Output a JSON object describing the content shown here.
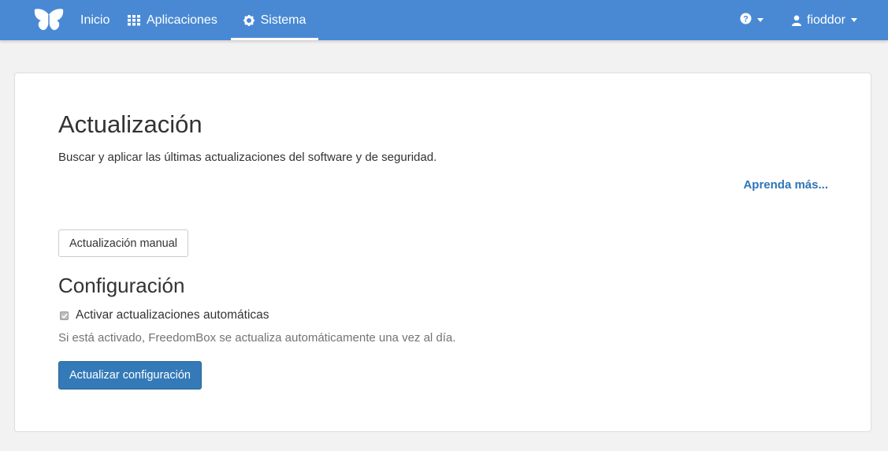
{
  "navbar": {
    "logo_icon": "butterfly-icon",
    "home_label": "Inicio",
    "apps_label": "Aplicaciones",
    "apps_icon": "grid-icon",
    "system_label": "Sistema",
    "system_icon": "gear-icon",
    "help_icon": "question-circle-icon",
    "user_icon": "user-icon",
    "user_label": "fioddor",
    "color": "#4989d4"
  },
  "page": {
    "title": "Actualización",
    "description": "Buscar y aplicar las últimas actualizaciones del software y de seguridad.",
    "learn_more": "Aprenda más...",
    "manual_button": "Actualización manual"
  },
  "config": {
    "title": "Configuración",
    "auto_update_label": "Activar actualizaciones automáticas",
    "auto_update_checked": true,
    "help_text": "Si está activado, FreedomBox se actualiza automáticamente una vez al día.",
    "submit_button": "Actualizar configuración",
    "submit_color": "#347ab8"
  }
}
